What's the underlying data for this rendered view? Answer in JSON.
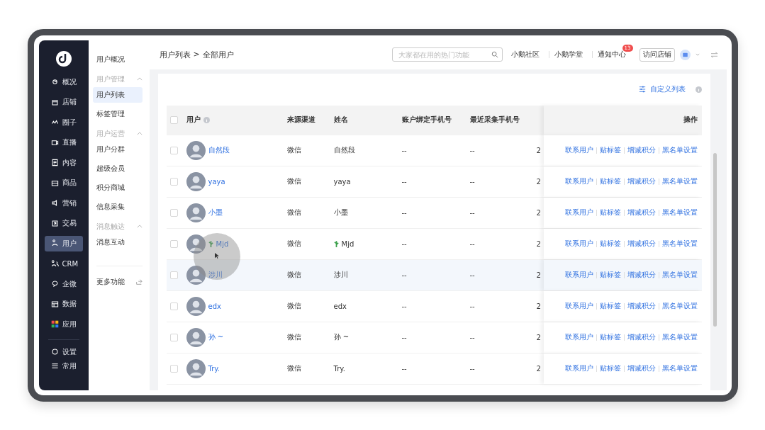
{
  "sidebar": {
    "items": [
      {
        "label": "概况",
        "selected": false
      },
      {
        "label": "店铺",
        "selected": false
      },
      {
        "label": "圈子",
        "selected": false
      },
      {
        "label": "直播",
        "selected": false
      },
      {
        "label": "内容",
        "selected": false
      },
      {
        "label": "商品",
        "selected": false
      },
      {
        "label": "营销",
        "selected": false
      },
      {
        "label": "交易",
        "selected": false
      },
      {
        "label": "用户",
        "selected": true
      },
      {
        "label": "CRM",
        "selected": false
      },
      {
        "label": "企微",
        "selected": false
      },
      {
        "label": "数据",
        "selected": false
      },
      {
        "label": "应用",
        "selected": false
      }
    ],
    "bottom_items": [
      {
        "label": "设置"
      },
      {
        "label": "常用"
      }
    ]
  },
  "subnav": {
    "top": {
      "label": "用户概况",
      "selected": false
    },
    "groups": [
      {
        "title": "用户管理",
        "expanded": true,
        "items": [
          {
            "label": "用户列表",
            "selected": true
          },
          {
            "label": "标签管理",
            "selected": false
          }
        ]
      },
      {
        "title": "用户运营",
        "expanded": true,
        "items": [
          {
            "label": "用户分群",
            "selected": false
          },
          {
            "label": "超级会员",
            "selected": false
          },
          {
            "label": "积分商城",
            "selected": false
          },
          {
            "label": "信息采集",
            "selected": false
          }
        ]
      },
      {
        "title": "消息触达",
        "expanded": true,
        "items": [
          {
            "label": "消息互动",
            "selected": false
          }
        ]
      }
    ],
    "more": "更多功能"
  },
  "header": {
    "breadcrumb": [
      "用户列表",
      "全部用户"
    ],
    "breadcrumb_separator": ">",
    "search": {
      "placeholder": "大家都在用的热门功能"
    },
    "links": [
      {
        "label": "小鹅社区"
      },
      {
        "label": "小鹅学堂"
      },
      {
        "label": "通知中心",
        "badge": "13"
      }
    ],
    "visit_button": "访问店铺"
  },
  "toolbar": {
    "customize": "自定义列表"
  },
  "table": {
    "columns": [
      "用户",
      "来源渠道",
      "姓名",
      "账户绑定手机号",
      "最近采集手机号",
      "操作"
    ],
    "select_all_checked": false,
    "rows": [
      {
        "kind": "plain",
        "checked": false,
        "user": "自然段",
        "channel": "微信",
        "name": "自然段",
        "bound_phone": "--",
        "recent_phone": "--",
        "column_7": "2",
        "hovered": false,
        "actions": [
          "联系用户",
          "贴标签",
          "增减积分",
          "黑名单设置"
        ]
      },
      {
        "kind": "plain",
        "checked": false,
        "user": "yaya",
        "channel": "微信",
        "name": "yaya",
        "bound_phone": "--",
        "recent_phone": "--",
        "column_7": "2",
        "hovered": false,
        "actions": [
          "联系用户",
          "贴标签",
          "增减积分",
          "黑名单设置"
        ]
      },
      {
        "kind": "plain",
        "checked": false,
        "user": "小墨",
        "channel": "微信",
        "name": "小墨",
        "bound_phone": "--",
        "recent_phone": "--",
        "column_7": "2",
        "hovered": false,
        "actions": [
          "联系用户",
          "贴标签",
          "增减积分",
          "黑名单设置"
        ]
      },
      {
        "kind": "plant",
        "checked": false,
        "user": "Mjd",
        "channel": "微信",
        "name": "Mjd",
        "bound_phone": "--",
        "recent_phone": "--",
        "column_7": "2",
        "hovered": false,
        "actions": [
          "联系用户",
          "贴标签",
          "增减积分",
          "黑名单设置"
        ]
      },
      {
        "kind": "plain",
        "checked": false,
        "user": "涉川",
        "channel": "微信",
        "name": "涉川",
        "bound_phone": "--",
        "recent_phone": "--",
        "column_7": "2",
        "hovered": true,
        "actions": [
          "联系用户",
          "贴标签",
          "增减积分",
          "黑名单设置"
        ]
      },
      {
        "kind": "plain",
        "checked": false,
        "user": "edx",
        "channel": "微信",
        "name": "edx",
        "bound_phone": "--",
        "recent_phone": "--",
        "column_7": "2",
        "hovered": false,
        "actions": [
          "联系用户",
          "贴标签",
          "增减积分",
          "黑名单设置"
        ]
      },
      {
        "kind": "plain",
        "checked": false,
        "user": "孙 ~",
        "channel": "微信",
        "name": "孙 ~",
        "bound_phone": "--",
        "recent_phone": "--",
        "column_7": "2",
        "hovered": false,
        "actions": [
          "联系用户",
          "贴标签",
          "增减积分",
          "黑名单设置"
        ]
      },
      {
        "kind": "plain",
        "checked": false,
        "user": "Try.",
        "channel": "微信",
        "name": "Try.",
        "bound_phone": "--",
        "recent_phone": "--",
        "column_7": "2",
        "hovered": false,
        "actions": [
          "联系用户",
          "贴标签",
          "增减积分",
          "黑名单设置"
        ]
      }
    ]
  }
}
